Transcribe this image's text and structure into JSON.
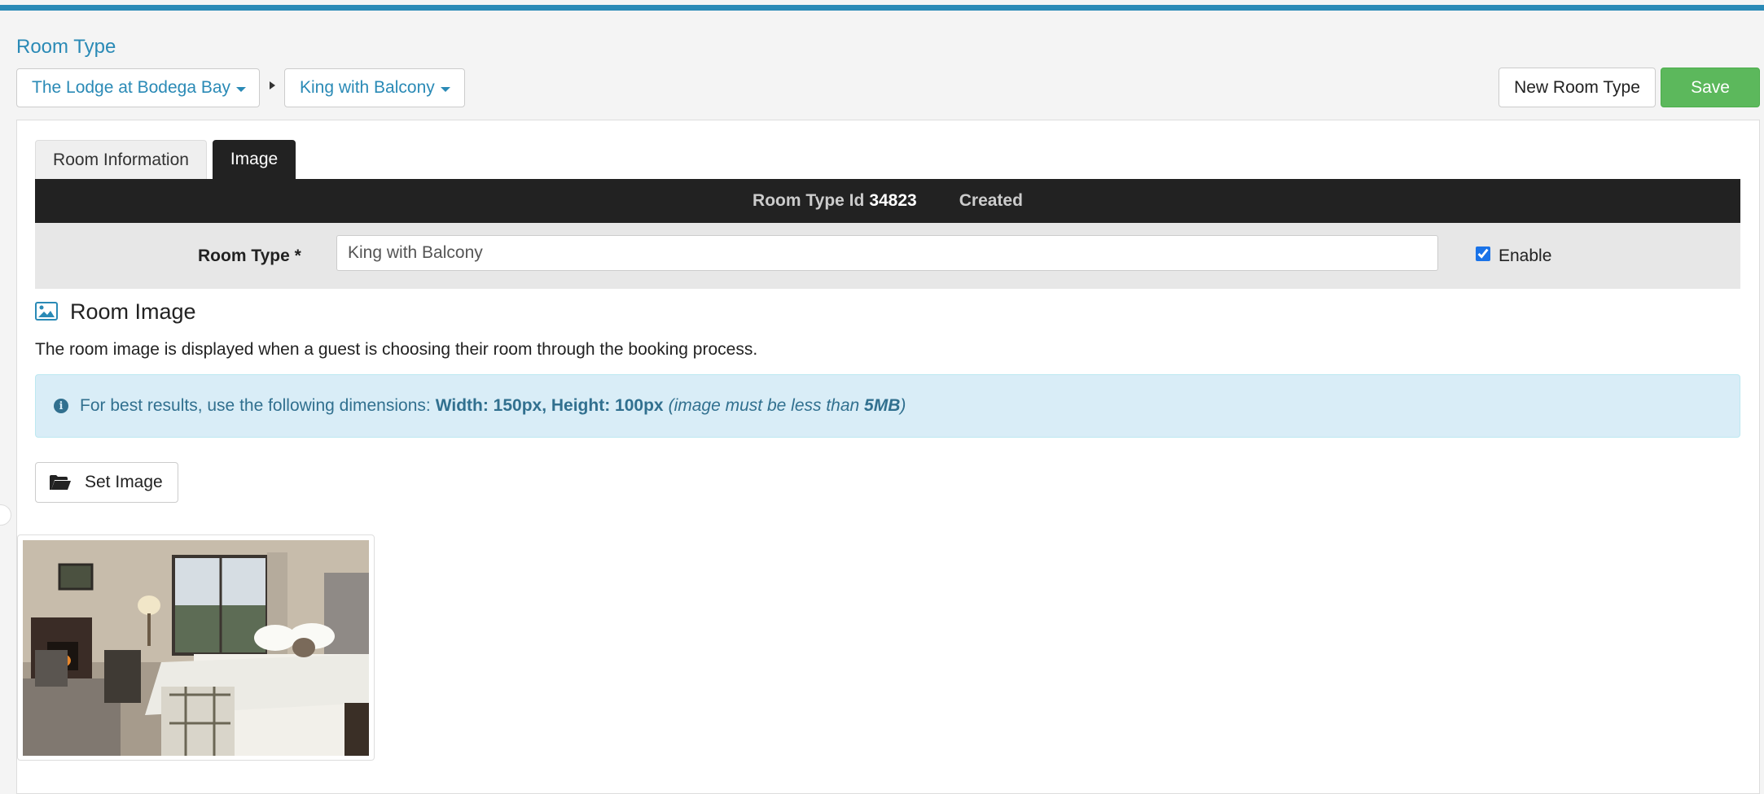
{
  "page": {
    "title": "Room Type"
  },
  "breadcrumb": {
    "hotel": "The Lodge at Bodega Bay",
    "room": "King with Balcony"
  },
  "actions": {
    "new_room_type": "New Room Type",
    "save": "Save"
  },
  "tabs": [
    {
      "label": "Room Information",
      "active": false
    },
    {
      "label": "Image",
      "active": true
    }
  ],
  "info_bar": {
    "id_label": "Room Type Id",
    "id_value": "34823",
    "created_label": "Created"
  },
  "form": {
    "room_type_label": "Room Type *",
    "room_type_value": "King with Balcony",
    "enable_label": "Enable",
    "enable_checked": true
  },
  "image_section": {
    "title": "Room Image",
    "description": "The room image is displayed when a guest is choosing their room through the booking process.",
    "alert_text": "For best results, use the following dimensions:",
    "alert_dims": "Width: 150px, Height: 100px",
    "alert_note_pre": "(image must be less than ",
    "alert_note_bold": "5MB",
    "alert_note_post": ")",
    "set_image_label": "Set Image"
  },
  "colors": {
    "accent": "#2a8ab6",
    "save": "#5cb85c",
    "alert_bg": "#d9edf7",
    "alert_text": "#31708f",
    "dark_bar": "#222222"
  },
  "icons": {
    "hotel_dropdown": "caret-down-icon",
    "section": "picture-icon",
    "alert": "info-circle-icon",
    "set_image": "folder-open-icon"
  }
}
